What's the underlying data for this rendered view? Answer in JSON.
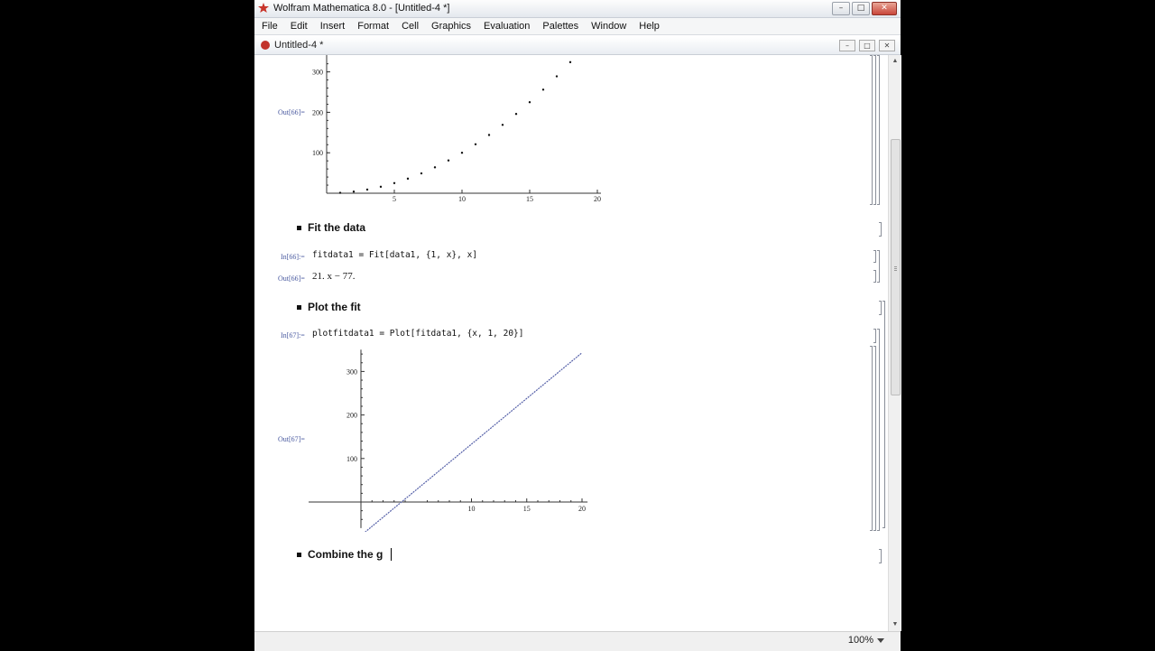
{
  "window": {
    "title": "Wolfram Mathematica 8.0 - [Untitled-4 *]",
    "min": "–",
    "max": "□",
    "close": "✕"
  },
  "menu": [
    "File",
    "Edit",
    "Insert",
    "Format",
    "Cell",
    "Graphics",
    "Evaluation",
    "Palettes",
    "Window",
    "Help"
  ],
  "document": {
    "title": "Untitled-4 *",
    "min": "–",
    "max": "□",
    "close": "✕"
  },
  "cells": {
    "out66_label": "Out[66]=",
    "section_fit": "Fit the data",
    "in66_label": "In[66]:=",
    "in66_code": "fitdata1 = Fit[data1, {1, x}, x]",
    "out66b_label": "Out[66]=",
    "out66b_value": "21. x − 77.",
    "section_plot": "Plot the fit",
    "in67_label": "In[67]:=",
    "in67_code": "plotfitdata1 = Plot[fitdata1, {x, 1, 20}]",
    "out67_label": "Out[67]=",
    "section_combine": "Combine the g"
  },
  "status": {
    "zoom": "100%"
  },
  "colors": {
    "output_label": "#4a5aa0",
    "line": "#5560a8",
    "close_button": "#c9463a"
  },
  "icons": [
    "mathematica-logo-icon",
    "scroll-up-icon",
    "scroll-down-icon",
    "zoom-dropdown-icon"
  ],
  "chart_data": [
    {
      "type": "scatter",
      "x": [
        1,
        2,
        3,
        4,
        5,
        6,
        7,
        8,
        9,
        10,
        11,
        12,
        13,
        14,
        15,
        16,
        17,
        18
      ],
      "y": [
        1,
        4,
        9,
        16,
        25,
        36,
        49,
        64,
        81,
        100,
        121,
        144,
        169,
        196,
        225,
        256,
        289,
        324
      ],
      "xticks": [
        5,
        10,
        15,
        20
      ],
      "yticks": [
        100,
        200,
        300
      ],
      "xlim": [
        0,
        20
      ],
      "ylim": [
        0,
        340
      ]
    },
    {
      "type": "line",
      "function": "21. x − 77.",
      "x": [
        1,
        20
      ],
      "y": [
        -56,
        343
      ],
      "xticks": [
        10,
        15,
        20
      ],
      "yticks": [
        100,
        200,
        300
      ],
      "xlim": [
        -5,
        20
      ],
      "ylim": [
        -56,
        350
      ]
    }
  ]
}
